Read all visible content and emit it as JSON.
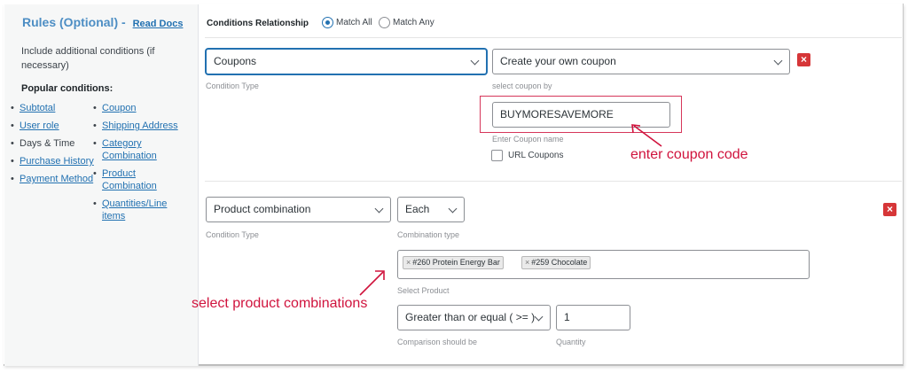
{
  "sidebar": {
    "title": "Rules (Optional)",
    "title_sep": "-",
    "read_docs": "Read Docs",
    "description": "Include additional conditions (if necessary)",
    "popular_heading": "Popular conditions:",
    "col1": [
      "Subtotal",
      "User role",
      "Days & Time",
      "Purchase History",
      "Payment Method"
    ],
    "col2": [
      "Coupon",
      "Shipping Address",
      "Category Combination",
      "Product Combination",
      "Quantities/Line items"
    ]
  },
  "header": {
    "label": "Conditions Relationship",
    "match_all": "Match All",
    "match_any": "Match Any",
    "selected": "Match All"
  },
  "condition1": {
    "type_value": "Coupons",
    "type_hint": "Condition Type",
    "coupon_mode": "Create your own coupon",
    "coupon_mode_hint": "select coupon by",
    "coupon_code": "BUYMORESAVEMORE",
    "coupon_code_hint": "Enter Coupon name",
    "url_coupons": "URL Coupons",
    "remove": "×"
  },
  "condition2": {
    "type_value": "Product combination",
    "type_hint": "Condition Type",
    "combination_value": "Each",
    "combination_hint": "Combination type",
    "products": [
      "#260 Protein Energy Bar",
      "#259 Chocolate"
    ],
    "products_hint": "Select Product",
    "tag_remove": "×",
    "comparison_value": "Greater than or equal ( >= )",
    "comparison_hint": "Comparison should be",
    "quantity_value": "1",
    "quantity_hint": "Quantity",
    "remove": "×"
  },
  "annotations": {
    "coupon": "enter coupon code",
    "products": "select product combinations"
  },
  "colors": {
    "accent": "#2271b1",
    "title": "#4d8ec4",
    "danger": "#d63638",
    "annotation": "#d0133d"
  }
}
